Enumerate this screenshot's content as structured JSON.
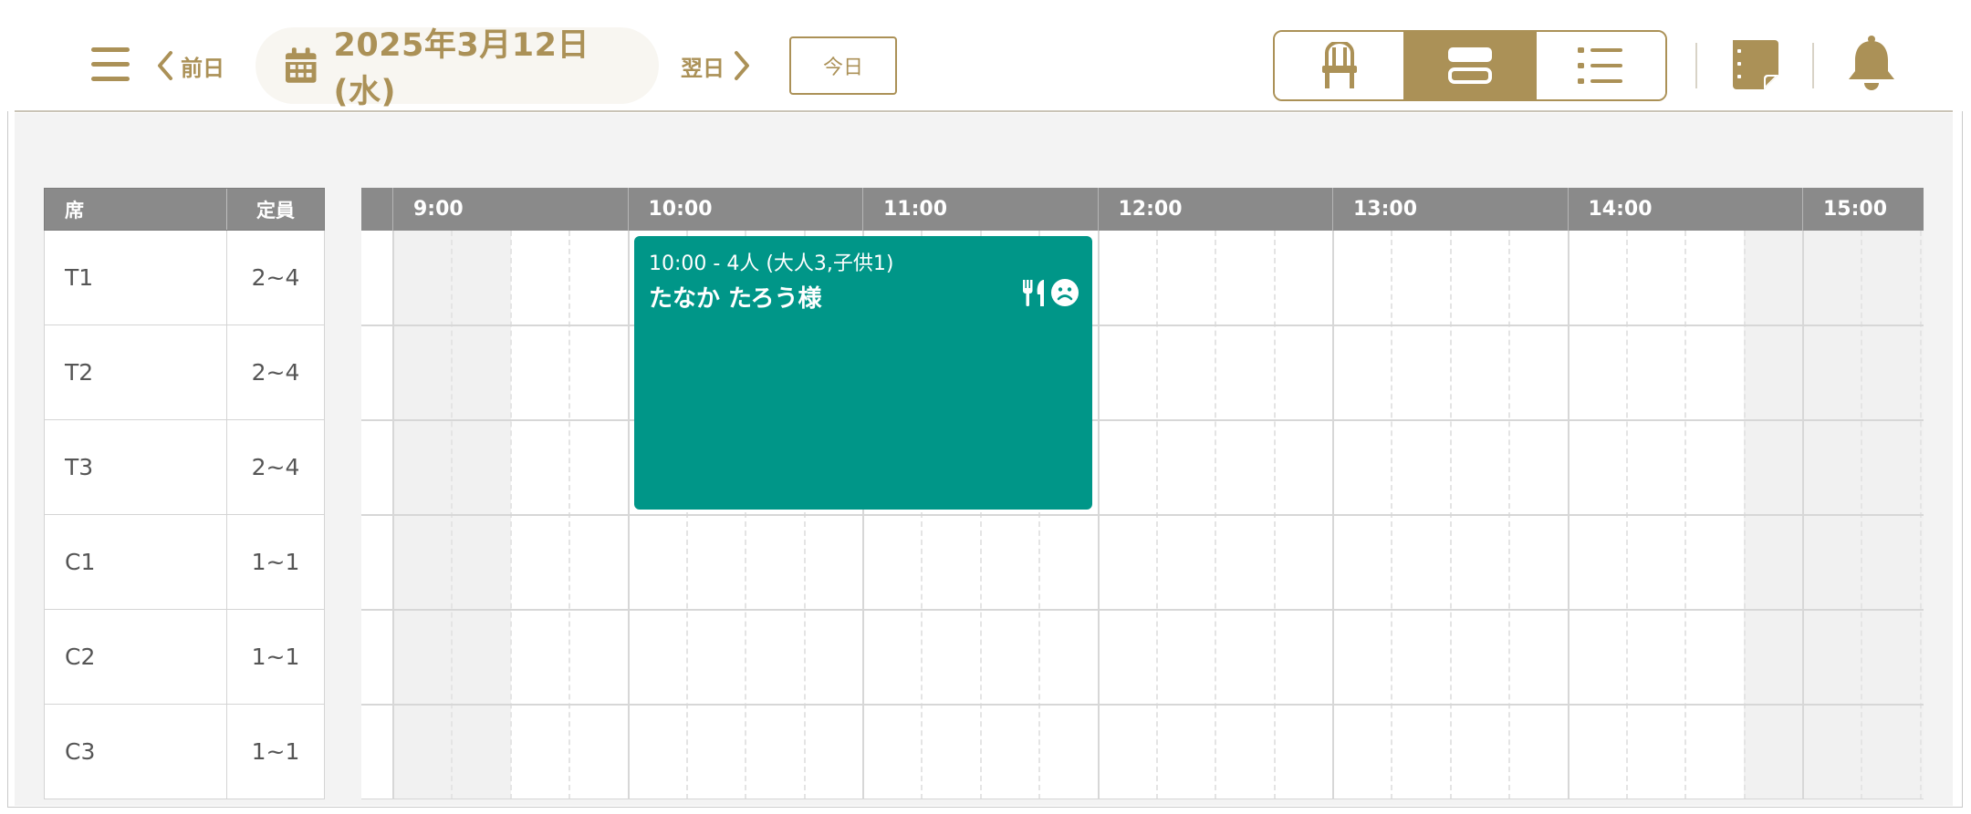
{
  "header": {
    "prev_label": "前日",
    "next_label": "翌日",
    "date": "2025年3月12日 (水)",
    "today_label": "今日",
    "views": [
      {
        "icon": "chair-icon",
        "active": false
      },
      {
        "icon": "timeline-icon",
        "active": true
      },
      {
        "icon": "list-icon",
        "active": false
      }
    ]
  },
  "colors": {
    "accent": "#ab9157",
    "reservation": "#009688",
    "header_gray": "#8a8a8a"
  },
  "seats": {
    "col_seat": "席",
    "col_capacity": "定員",
    "rows": [
      {
        "name": "T1",
        "capacity": "2~4"
      },
      {
        "name": "T2",
        "capacity": "2~4"
      },
      {
        "name": "T3",
        "capacity": "2~4"
      },
      {
        "name": "C1",
        "capacity": "1~1"
      },
      {
        "name": "C2",
        "capacity": "1~1"
      },
      {
        "name": "C3",
        "capacity": "1~1"
      }
    ]
  },
  "timeline": {
    "hours": [
      "9:00",
      "10:00",
      "11:00",
      "12:00",
      "13:00",
      "14:00",
      "15:00"
    ]
  },
  "reservation": {
    "time_info": "10:00 - 4人 (大人3,子供1)",
    "name": "たなか たろう様",
    "icons": [
      "utensils-icon",
      "frown-face-icon"
    ]
  }
}
